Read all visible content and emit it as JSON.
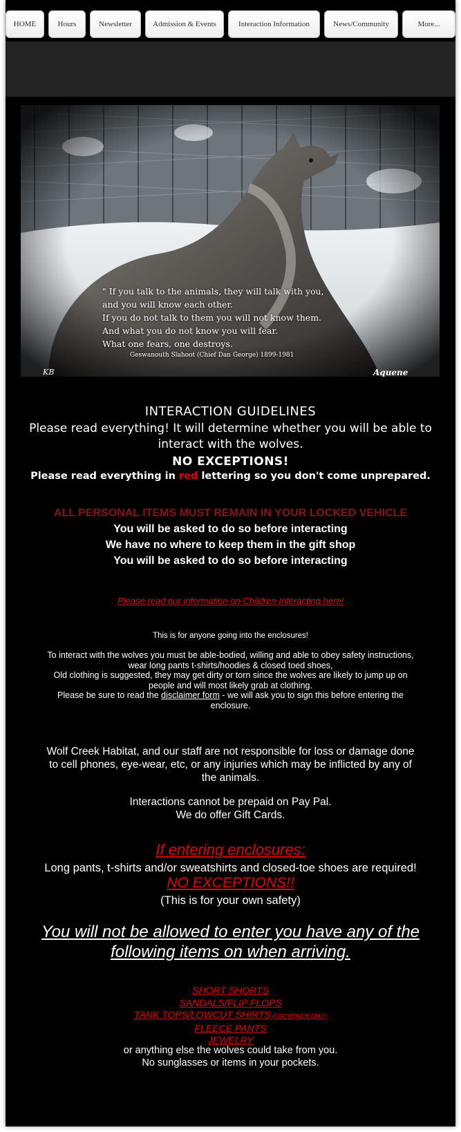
{
  "nav": {
    "items": [
      {
        "label": "HOME"
      },
      {
        "label": "Hours"
      },
      {
        "label": "Newsletter"
      },
      {
        "label": "Admission & Events"
      },
      {
        "label": "Interaction Information"
      },
      {
        "label": "News/Community"
      },
      {
        "label": "More..."
      }
    ]
  },
  "hero": {
    "quote_lines": [
      "\" If you talk to the animals, they will talk with you,",
      "and you will know each other.",
      "If you do not talk to them you will not know them.",
      "And what you do not know you will fear.",
      "What one fears, one destroys."
    ],
    "attribution": "Geswanouth Slahoot (Chief Dan George) 1899-1981",
    "sig_left": "KB",
    "sig_right": "Aquene"
  },
  "guidelines": {
    "title": "INTERACTION GUIDELINES",
    "intro": "Please read everything! It will determine whether you will be able to interact with the wolves.",
    "no_exceptions": "NO EXCEPTIONS!",
    "read_prefix": "Please read everything in ",
    "read_red": "red",
    "read_suffix": " lettering so you don't come unprepared."
  },
  "personal": {
    "heading": "ALL PERSONAL ITEMS MUST REMAIN IN YOUR LOCKED VEHICLE",
    "line1": "You will be asked to do so before interacting",
    "line2": "We have no where to keep them in the gift shop",
    "line3": "You will be asked to do so before interacting"
  },
  "children_link": "Please read our information on Children Interacting here!",
  "enclosure": {
    "note": "This is for anyone going into the enclosures!",
    "line1": "To interact with the wolves you must be able-bodied, willing and able to obey safety instructions,",
    "line2": "wear long pants t-shirts/hoodies & closed toed shoes,",
    "line3": "Old clothing is suggested, they may get dirty or torn since the wolves are likely to jump up on",
    "line4": "people and will most likely grab at clothing.",
    "line5_prefix": "Please be sure to read the ",
    "line5_link": "disclaimer form",
    "line5_suffix": " - we will ask you to sign this before entering the",
    "line6": "enclosure."
  },
  "liability": {
    "line1": "Wolf Creek Habitat, and our staff are not responsible for loss or damage done",
    "line2": "to cell phones, eye-wear, etc, or any injuries which may be inflicted by any of",
    "line3": "the animals."
  },
  "payment": {
    "line1": "Interactions cannot be prepaid on Pay Pal.",
    "line2": "We do offer Gift Cards."
  },
  "entering": {
    "heading": "If entering enclosures:",
    "required": "Long pants, t-shirts and/or sweatshirts and closed-toe shoes are required!",
    "no_exceptions": "NO EXCEPTIONS!!",
    "safety": "(This is for your own safety)"
  },
  "not_allowed": {
    "line1": "You will not be allowed to enter you have any of the",
    "line2": "following items on when arriving."
  },
  "items": {
    "list": [
      {
        "label": "SHORT SHORTS",
        "note": ""
      },
      {
        "label": "SANDALS/FLIP FLOPS",
        "note": ""
      },
      {
        "label": "TANK TOPS/LOWCUT SHIRTS",
        "note": " (FOR WOMEN ONLY)"
      },
      {
        "label": "FLEECE PANTS",
        "note": ""
      },
      {
        "label": "JEWELRY",
        "note": ""
      }
    ],
    "footer1": "or anything else the wolves could take from you.",
    "footer2": "No sunglasses or items in your pockets."
  }
}
